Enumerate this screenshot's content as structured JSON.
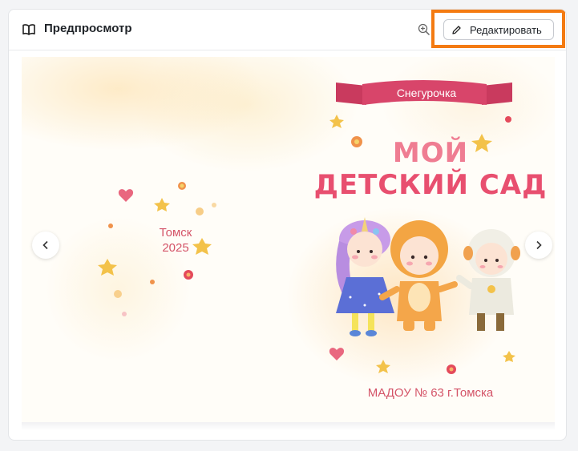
{
  "header": {
    "title": "Предпросмотр",
    "edit_label": "Редактировать",
    "icons": [
      "book-icon",
      "zoom-in-icon",
      "pencil-icon"
    ]
  },
  "preview": {
    "back_cover": {
      "city": "Томск",
      "year": "2025"
    },
    "front_cover": {
      "ribbon": "Снегурочка",
      "title_line1": "МОЙ",
      "title_line2": "ДЕТСКИЙ САД",
      "school": "МАДОУ № 63 г.Томска"
    },
    "nav": {
      "prev_icon": "chevron-left-icon",
      "next_icon": "chevron-right-icon"
    }
  },
  "colors": {
    "highlight": "#f47b12",
    "title_pink": "#e84f6f",
    "text_pink": "#d45468",
    "ribbon": "#d8456a"
  }
}
